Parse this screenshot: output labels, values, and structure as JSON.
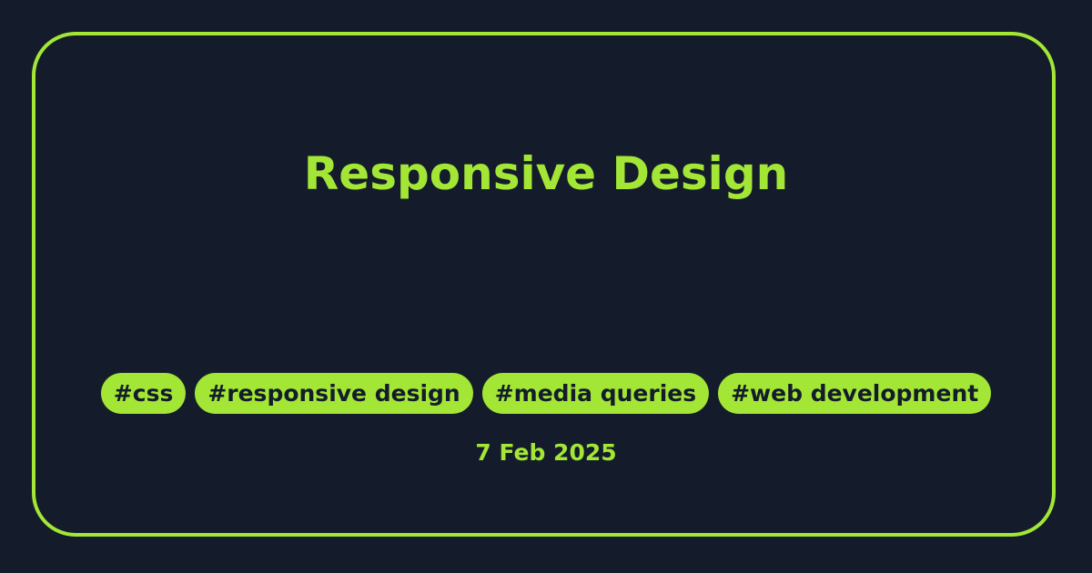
{
  "card": {
    "title": "Responsive Design",
    "tags": [
      "#css",
      "#responsive design",
      "#media queries",
      "#web development"
    ],
    "date": "7 Feb 2025"
  },
  "colors": {
    "background": "#141c2b",
    "accent": "#a3e635"
  }
}
